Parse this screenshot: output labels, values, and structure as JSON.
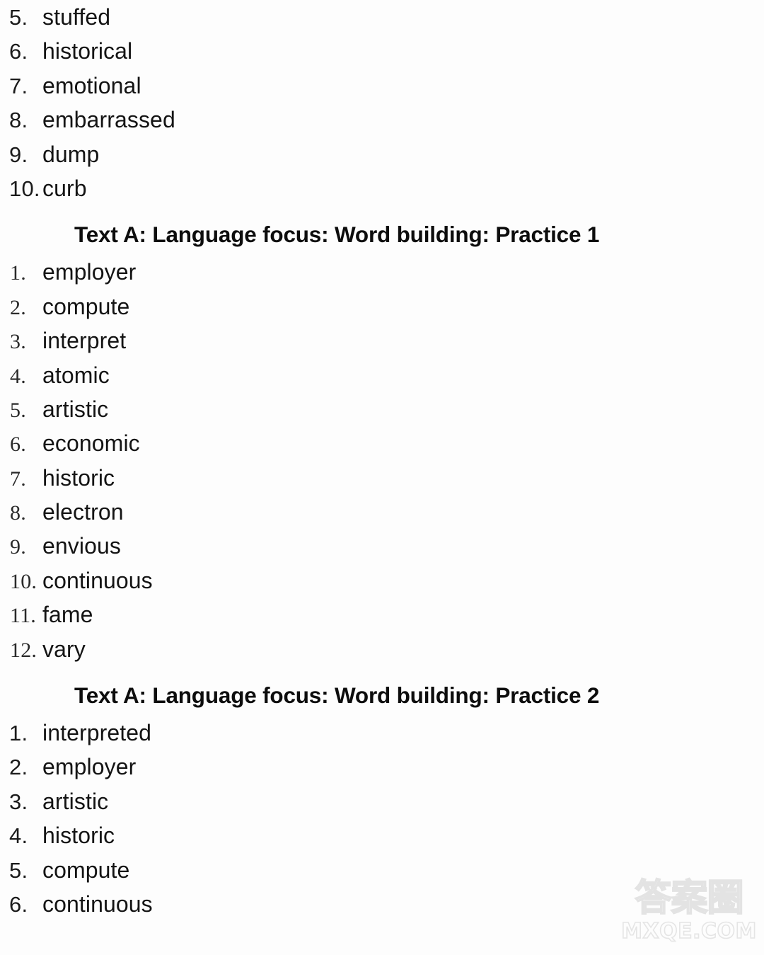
{
  "document": {
    "background_color": "#fdfdfd",
    "text_color": "#141414",
    "blocks": [
      {
        "id": "block-a",
        "type": "numbered-list",
        "heading": null,
        "items": [
          {
            "number": "5.",
            "word": "stuffed"
          },
          {
            "number": "6.",
            "word": "historical"
          },
          {
            "number": "7.",
            "word": "emotional"
          },
          {
            "number": "8.",
            "word": "embarrassed"
          },
          {
            "number": "9.",
            "word": "dump"
          },
          {
            "number": "10.",
            "word": "curb"
          }
        ]
      },
      {
        "id": "block-b",
        "type": "numbered-list",
        "heading": "Text A: Language focus: Word building: Practice 1",
        "items": [
          {
            "number": "1.",
            "word": "employer"
          },
          {
            "number": "2.",
            "word": "compute"
          },
          {
            "number": "3.",
            "word": "interpret"
          },
          {
            "number": "4.",
            "word": "atomic"
          },
          {
            "number": "5.",
            "word": "artistic"
          },
          {
            "number": "6.",
            "word": "economic"
          },
          {
            "number": "7.",
            "word": "historic"
          },
          {
            "number": "8.",
            "word": "electron"
          },
          {
            "number": "9.",
            "word": "envious"
          },
          {
            "number": "10.",
            "word": "continuous"
          },
          {
            "number": "11.",
            "word": "fame"
          },
          {
            "number": "12.",
            "word": "vary"
          }
        ]
      },
      {
        "id": "block-c",
        "type": "numbered-list",
        "heading": "Text A: Language focus: Word building: Practice 2",
        "items": [
          {
            "number": "1.",
            "word": "interpreted"
          },
          {
            "number": "2.",
            "word": "employer"
          },
          {
            "number": "3.",
            "word": "artistic"
          },
          {
            "number": "4.",
            "word": "historic"
          },
          {
            "number": "5.",
            "word": "compute"
          },
          {
            "number": "6.",
            "word": "continuous"
          }
        ]
      }
    ]
  },
  "watermark": {
    "chinese_text": "答案圈",
    "url_text": "MXQE.COM",
    "color": "#e4e4e4"
  }
}
